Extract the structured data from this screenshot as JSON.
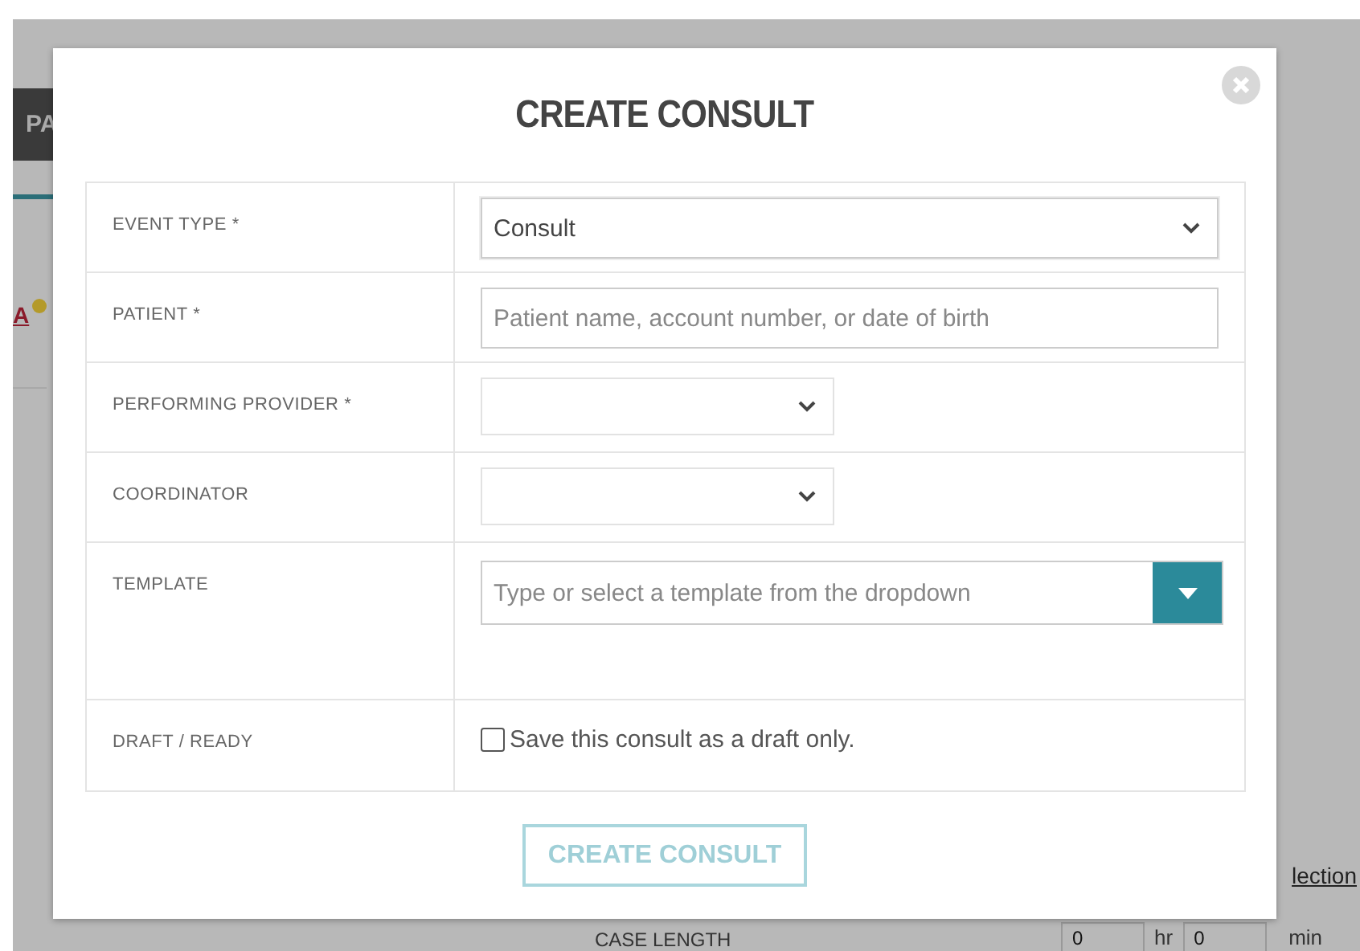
{
  "background": {
    "nav_label": "PA",
    "link": "A",
    "side_link": "lection",
    "case_length": {
      "label": "CASE LENGTH",
      "hours": "0",
      "hours_unit": "hr",
      "minutes": "0",
      "minutes_unit": "min"
    }
  },
  "dialog": {
    "title": "CREATE CONSULT",
    "fields": [
      {
        "label": "EVENT TYPE *",
        "kind": "select",
        "value": "Consult"
      },
      {
        "label": "PATIENT *",
        "kind": "text",
        "placeholder": "Patient name, account number, or date of birth"
      },
      {
        "label": "PERFORMING PROVIDER *",
        "kind": "short-select"
      },
      {
        "label": "COORDINATOR",
        "kind": "short-select"
      },
      {
        "label": "TEMPLATE",
        "kind": "combo",
        "placeholder": "Type or select a template from the dropdown"
      },
      {
        "label": "DRAFT / READY",
        "kind": "checkbox",
        "text": "Save this consult as a draft only.",
        "checked": false
      }
    ],
    "submit": {
      "label": "CREATE CONSULT",
      "disabled": true
    }
  }
}
